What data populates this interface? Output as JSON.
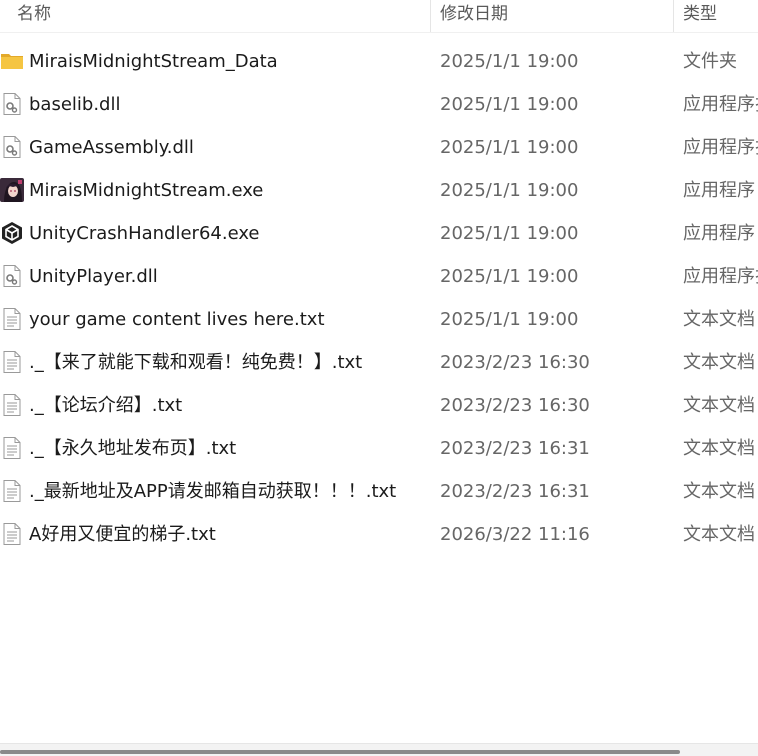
{
  "columns": {
    "name": "名称",
    "date": "修改日期",
    "type": "类型"
  },
  "files": [
    {
      "name": "MiraisMidnightStream_Data",
      "date": "2025/1/1 19:00",
      "type": "文件夹",
      "icon": "folder-icon"
    },
    {
      "name": "baselib.dll",
      "date": "2025/1/1 19:00",
      "type": "应用程序扩展",
      "icon": "dll-icon"
    },
    {
      "name": "GameAssembly.dll",
      "date": "2025/1/1 19:00",
      "type": "应用程序扩展",
      "icon": "dll-icon"
    },
    {
      "name": "MiraisMidnightStream.exe",
      "date": "2025/1/1 19:00",
      "type": "应用程序",
      "icon": "game-app-icon"
    },
    {
      "name": "UnityCrashHandler64.exe",
      "date": "2025/1/1 19:00",
      "type": "应用程序",
      "icon": "unity-icon"
    },
    {
      "name": "UnityPlayer.dll",
      "date": "2025/1/1 19:00",
      "type": "应用程序扩展",
      "icon": "dll-icon"
    },
    {
      "name": "your game content lives here.txt",
      "date": "2025/1/1 19:00",
      "type": "文本文档",
      "icon": "text-file-icon"
    },
    {
      "name": "._【来了就能下载和观看！纯免费！】.txt",
      "date": "2023/2/23 16:30",
      "type": "文本文档",
      "icon": "text-file-icon"
    },
    {
      "name": "._【论坛介绍】.txt",
      "date": "2023/2/23 16:30",
      "type": "文本文档",
      "icon": "text-file-icon"
    },
    {
      "name": "._【永久地址发布页】.txt",
      "date": "2023/2/23 16:31",
      "type": "文本文档",
      "icon": "text-file-icon"
    },
    {
      "name": "._最新地址及APP请发邮箱自动获取！！！.txt",
      "date": "2023/2/23 16:31",
      "type": "文本文档",
      "icon": "text-file-icon"
    },
    {
      "name": "A好用又便宜的梯子.txt",
      "date": "2026/3/22 11:16",
      "type": "文本文档",
      "icon": "text-file-icon"
    }
  ],
  "colors": {
    "folder": "#f5c542",
    "folder_dark": "#e3a92a",
    "dll_gray": "#7a7a7a",
    "unity_dark": "#222222"
  }
}
